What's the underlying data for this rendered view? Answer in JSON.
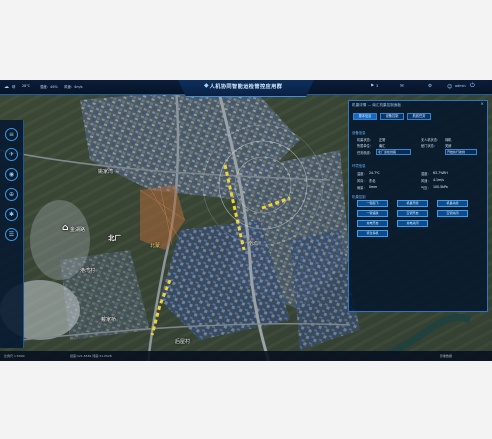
{
  "header": {
    "title": "人机协同智能运检管控应用群",
    "weather": "晴",
    "temperature": "28℃",
    "humidity": "湿度：46%",
    "wind": "风速：4m/s",
    "alert_count": "3",
    "user_label": "admin"
  },
  "map": {
    "labels": [
      {
        "text": "姚家湾"
      },
      {
        "text": "北厂"
      },
      {
        "text": "金湖路"
      },
      {
        "text": "港湾村"
      },
      {
        "text": "戴家桥"
      },
      {
        "text": "后屋村"
      },
      {
        "text": "南坞"
      }
    ],
    "mark_label": "北蒙"
  },
  "left_toolbar": {
    "tools": [
      {
        "icon": "layers-icon"
      },
      {
        "icon": "drone-icon"
      },
      {
        "icon": "location-icon"
      },
      {
        "icon": "target-icon"
      },
      {
        "icon": "settings-icon"
      },
      {
        "icon": "list-icon"
      }
    ]
  },
  "panel": {
    "title": "机巢详情 — 南汇机巢控制面板",
    "tabs": [
      "基本信息",
      "设备控制",
      "航线任务"
    ],
    "device_section": "设备信息",
    "fields": [
      {
        "label": "机巢状态：",
        "value": "正常"
      },
      {
        "label": "无人机状态：",
        "value": "待机"
      },
      {
        "label": "所属单位：",
        "value": "南汇"
      },
      {
        "label": "舱门状态：",
        "value": "关闭"
      }
    ],
    "select_label": "任务航线：",
    "select_value": "北厂巡检线路",
    "select2_value": "开始执行航线",
    "env_section": "环境信息",
    "env": [
      {
        "label": "温度：",
        "value": "24.7℃"
      },
      {
        "label": "湿度：",
        "value": "63.7%RH"
      },
      {
        "label": "风向：",
        "value": "东北"
      },
      {
        "label": "风速：",
        "value": "4.1m/s"
      },
      {
        "label": "雨量：",
        "value": "0mm"
      },
      {
        "label": "气压：",
        "value": "100.5kPa"
      }
    ],
    "control_section": "机巢控制",
    "buttons": [
      "一键起飞",
      "机巢开舱",
      "机巢关舱",
      "一键返航",
      "空调开启",
      "空调关闭",
      "充电开启",
      "充电关闭",
      "紧急停机"
    ]
  },
  "bottom": {
    "scale": "比例尺 1:5000",
    "coords": "经度:121.6536 纬度:31.0528",
    "source": "影像数据"
  }
}
